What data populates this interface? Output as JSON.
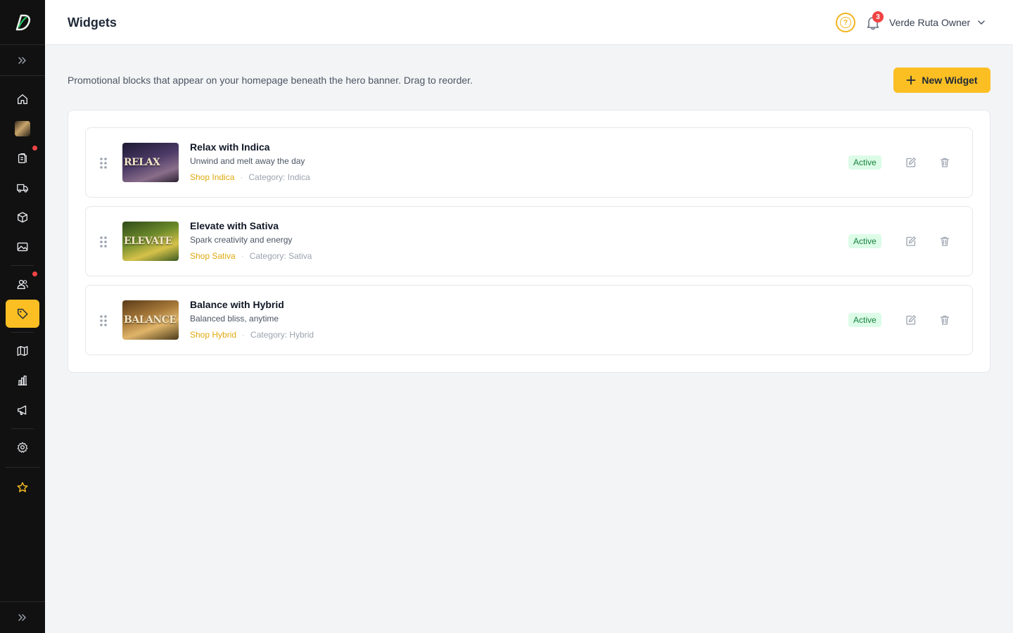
{
  "header": {
    "title": "Widgets",
    "help_icon": "question-circle-icon",
    "notification_count": "3",
    "user_name": "Verde Ruta Owner"
  },
  "sidebar": {
    "items": [
      {
        "name": "home",
        "icon": "home-icon"
      },
      {
        "name": "store",
        "icon": "store-thumbnail-icon"
      },
      {
        "name": "orders",
        "icon": "clipboard-icon",
        "dot": true
      },
      {
        "name": "delivery",
        "icon": "truck-icon"
      },
      {
        "name": "products",
        "icon": "box-icon"
      },
      {
        "name": "media",
        "icon": "image-icon"
      },
      {
        "name": "customers",
        "icon": "users-icon",
        "dot": true
      },
      {
        "name": "promotions",
        "icon": "tag-icon",
        "active": true
      },
      {
        "name": "guides",
        "icon": "map-icon"
      },
      {
        "name": "analytics",
        "icon": "bar-chart-icon"
      },
      {
        "name": "marketing",
        "icon": "megaphone-icon"
      },
      {
        "name": "settings",
        "icon": "gear-icon"
      },
      {
        "name": "favorites",
        "icon": "star-icon"
      }
    ]
  },
  "content": {
    "description": "Promotional blocks that appear on your homepage beneath the hero banner. Drag to reorder.",
    "new_button_label": "New Widget"
  },
  "widgets": [
    {
      "title": "Relax with Indica",
      "subtitle": "Unwind and melt away the day",
      "link": "Shop Indica",
      "category": "Category: Indica",
      "status": "Active",
      "thumb_word": "RELAX",
      "thumb_colors": [
        "#2b2440",
        "#6b4f7a"
      ]
    },
    {
      "title": "Elevate with Sativa",
      "subtitle": "Spark creativity and energy",
      "link": "Shop Sativa",
      "category": "Category: Sativa",
      "status": "Active",
      "thumb_word": "ELEVATE",
      "thumb_colors": [
        "#3d5a1e",
        "#c9b34a"
      ]
    },
    {
      "title": "Balance with Hybrid",
      "subtitle": "Balanced bliss, anytime",
      "link": "Shop Hybrid",
      "category": "Category: Hybrid",
      "status": "Active",
      "thumb_word": "BALANCE",
      "thumb_colors": [
        "#6b4a22",
        "#d4a15a"
      ]
    }
  ],
  "colors": {
    "accent": "#fbbf24",
    "sidebar_bg": "#111111",
    "active_status_bg": "#dcfce7",
    "active_status_text": "#15803d",
    "link": "#e0a90f"
  }
}
